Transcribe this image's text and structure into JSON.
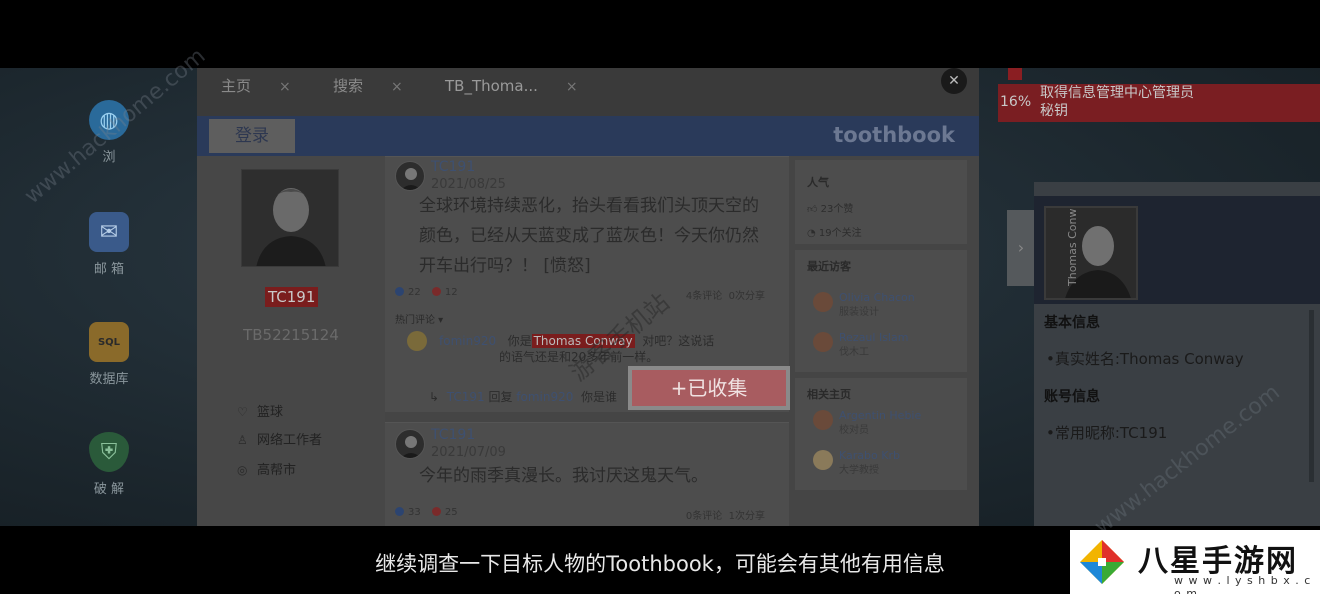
{
  "subtitle": "继续调查一下目标人物的Toothbook，可能会有其他有用信息",
  "desktop_icons": [
    {
      "label": "浏",
      "icon": "globe-icon"
    },
    {
      "label": "邮 箱",
      "icon": "mail-icon"
    },
    {
      "label": "数据库",
      "icon": "sql-icon"
    },
    {
      "label": "破 解",
      "icon": "shield-icon"
    }
  ],
  "browser": {
    "tabs": [
      {
        "label": "主页",
        "close": "×"
      },
      {
        "label": "搜索",
        "close": "×"
      },
      {
        "label": "TB_Thoma...",
        "close": "×"
      }
    ],
    "close_glyph": "✕",
    "login_label": "登录",
    "brand": "toothbook"
  },
  "profile": {
    "nickname": "TC191",
    "tb_id": "TB52215124",
    "info": [
      {
        "icon": "heart-icon",
        "glyph": "♡",
        "text": "篮球"
      },
      {
        "icon": "tie-icon",
        "glyph": "♙",
        "text": "网络工作者"
      },
      {
        "icon": "location-icon",
        "glyph": "◎",
        "text": "高帮市"
      }
    ]
  },
  "posts": [
    {
      "author": "TC191",
      "date": "2021/08/25",
      "text": "全球环境持续恶化，抬头看看我们头顶天空的颜色，已经从天蓝变成了蓝灰色！今天你仍然开车出行吗？！ [愤怒]",
      "likes": "22",
      "hearts": "12",
      "comments": "4条评论",
      "shares": "0次分享",
      "hot_label": "热门评论 ▾",
      "hot_comment": {
        "user": "fomin920",
        "pre": "你是",
        "highlight": "Thomas Conway",
        "post": "对吧？这说话",
        "line2": "的语气还是和20多年前一样。"
      },
      "reply": {
        "user": "TC191",
        "verb": "回复",
        "target": "fomin920",
        "text": "你是谁"
      }
    },
    {
      "author": "TC191",
      "date": "2021/07/09",
      "text": "今年的雨季真漫长。我讨厌这鬼天气。",
      "likes": "33",
      "hearts": "25",
      "comments": "0条评论",
      "shares": "1次分享"
    }
  ],
  "sidebar": {
    "popularity_title": "人气",
    "likes": "23个赞",
    "follows": "19个关注",
    "visitors_title": "最近访客",
    "visitors": [
      {
        "name": "Olivia Chacon",
        "title": "服装设计"
      },
      {
        "name": "Rezaul Islam",
        "title": "伐木工"
      }
    ],
    "related_title": "相关主页",
    "related": [
      {
        "name": "Argentin Hebie",
        "title": "校对员"
      },
      {
        "name": "Karabo Krb",
        "title": "大学教授"
      }
    ]
  },
  "collect_button": "+已收集",
  "quest": {
    "percent": "16%",
    "text_line1": "取得信息管理中心管理员",
    "text_line2": "秘钥"
  },
  "info_panel": {
    "photo_name": "Thomas Conway",
    "basic_title": "基本信息",
    "real_name": "•真实姓名:Thomas Conway",
    "account_title": "账号信息",
    "nickname": "•常用昵称:TC191",
    "arrow": "›"
  },
  "watermarks": {
    "left": "www.hackhome.com",
    "right": "www.hackhome.com",
    "center": "游客手机站"
  },
  "logo": {
    "text": "八星手游网",
    "url": "w w w . l y s h b x . c o m"
  }
}
